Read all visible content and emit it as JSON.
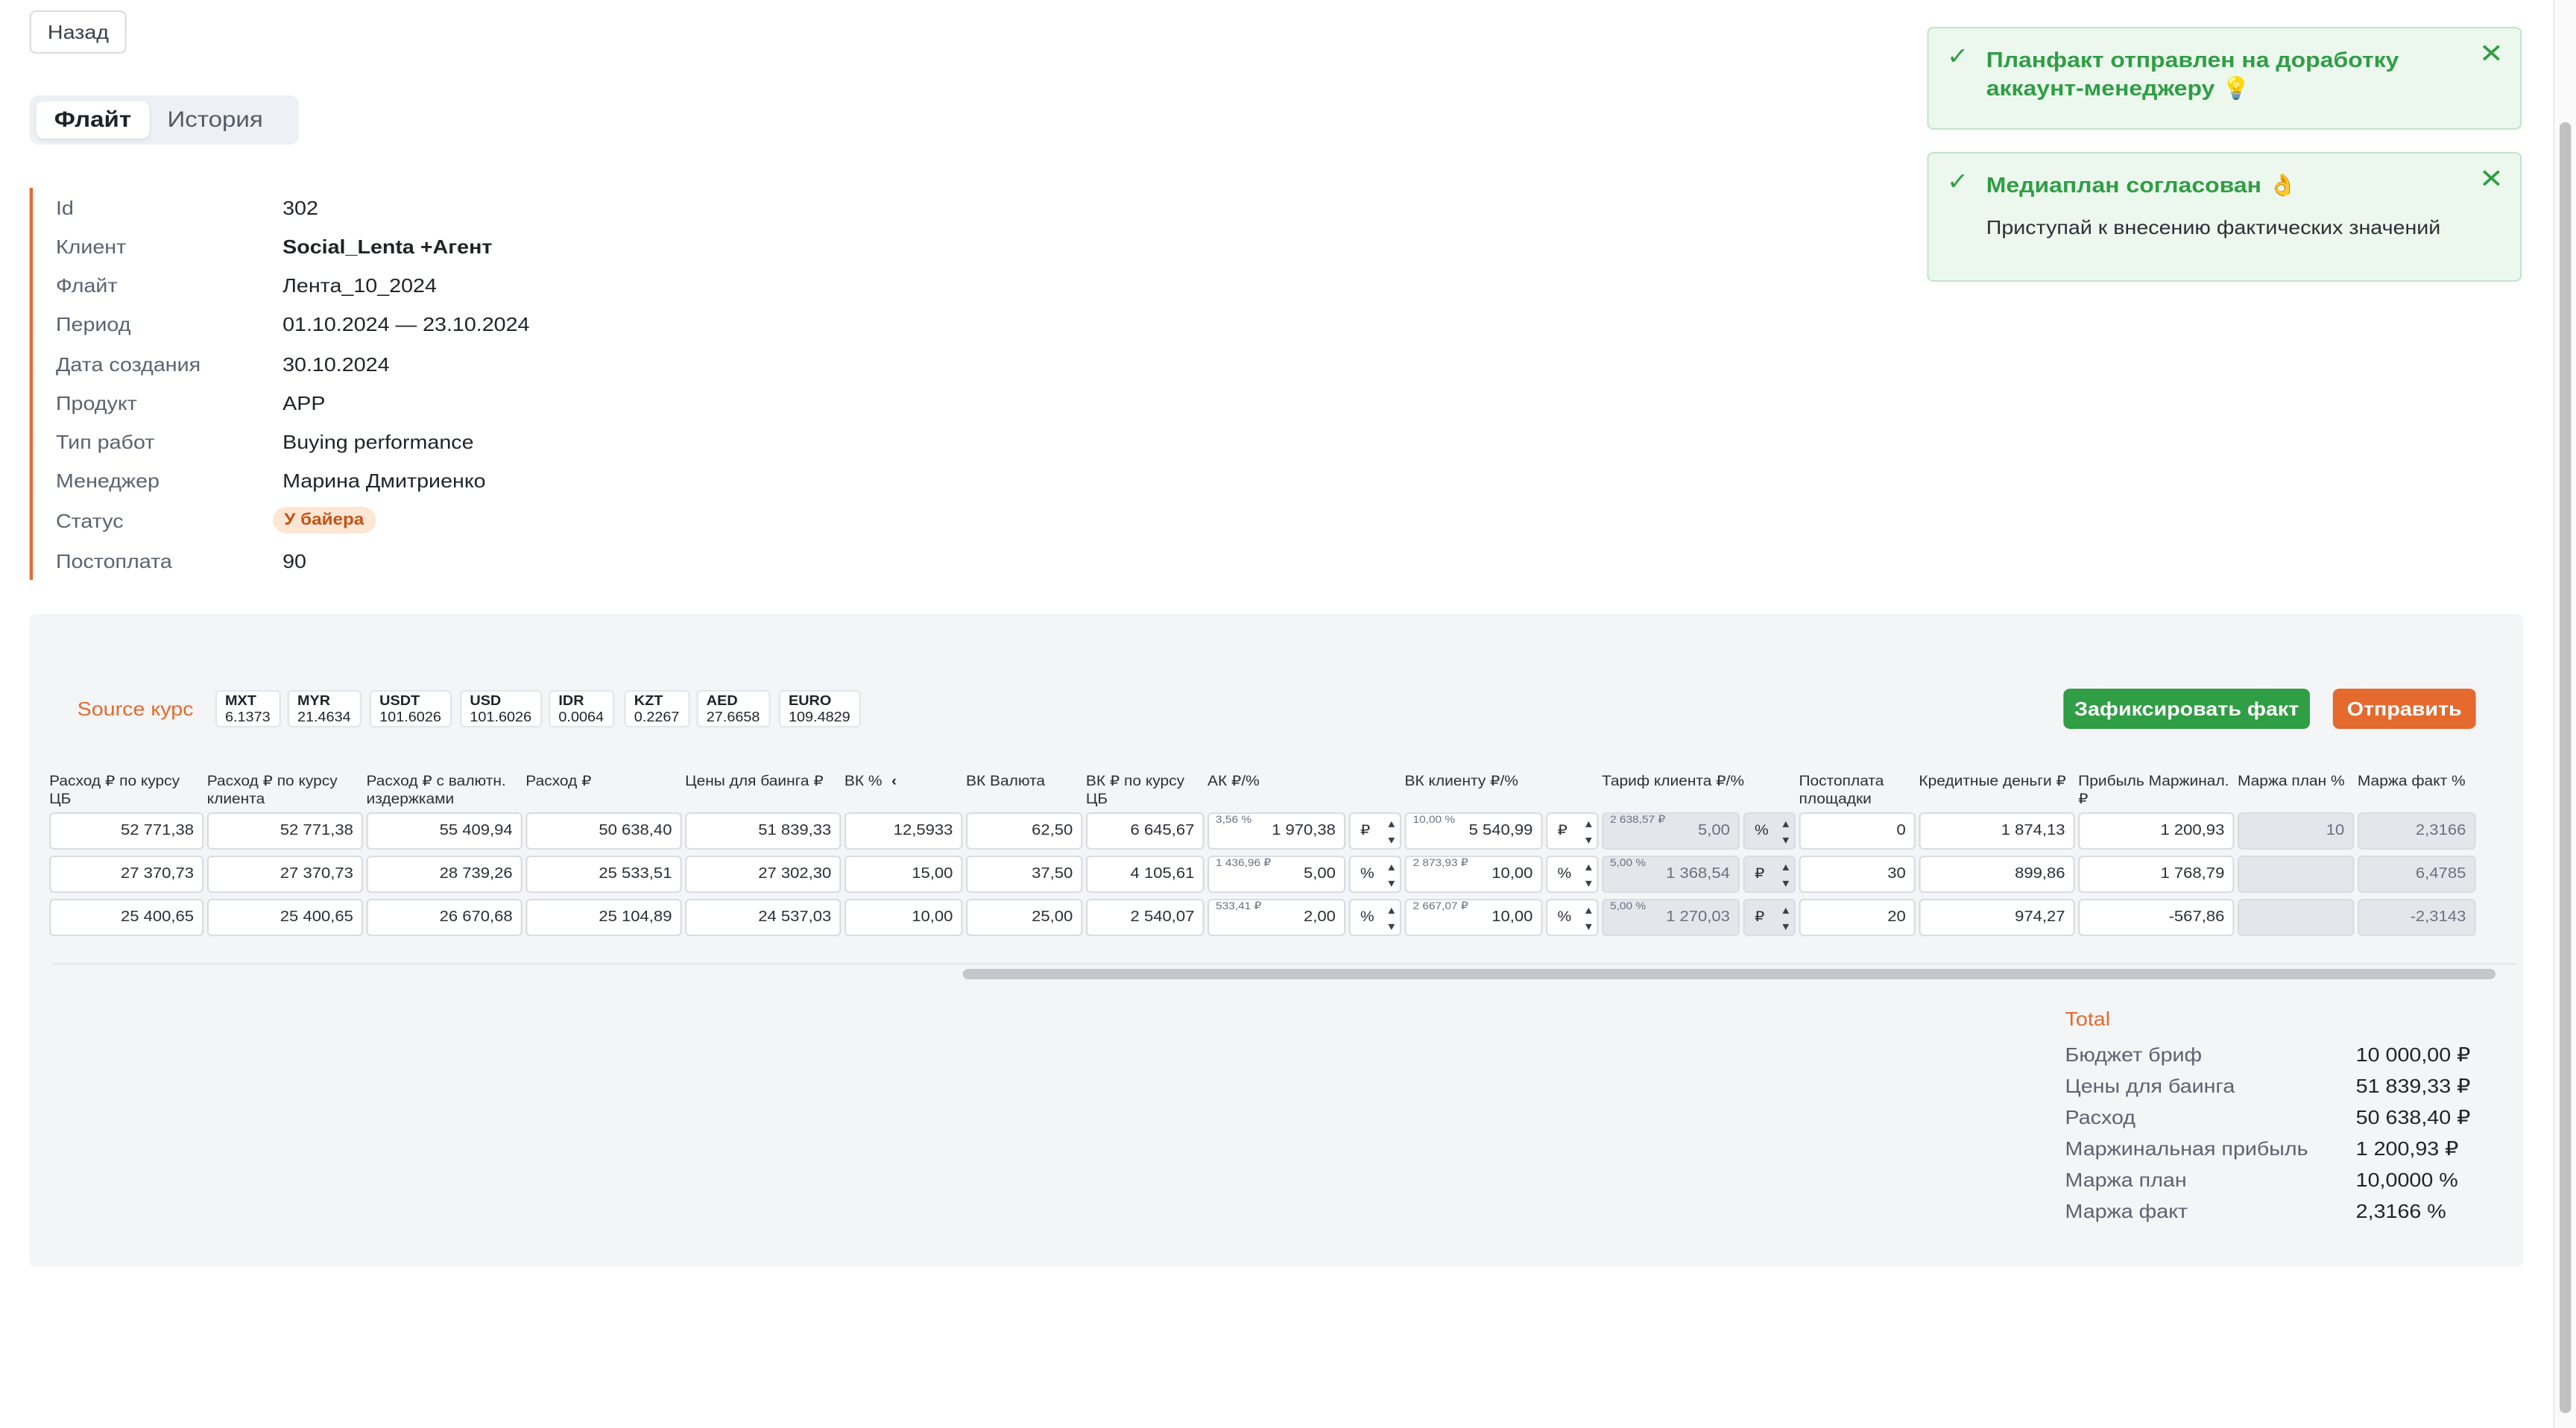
{
  "header": {
    "back_label": "Назад"
  },
  "tabs": [
    {
      "label": "Флайт"
    },
    {
      "label": "История"
    }
  ],
  "info": {
    "rows": [
      {
        "label": "Id",
        "value": "302"
      },
      {
        "label": "Клиент",
        "value": "Social_Lenta +Агент"
      },
      {
        "label": "Флайт",
        "value": "Лента_10_2024"
      },
      {
        "label": "Период",
        "value": "01.10.2024 — 23.10.2024"
      },
      {
        "label": "Дата создания",
        "value": "30.10.2024"
      },
      {
        "label": "Продукт",
        "value": "APP"
      },
      {
        "label": "Тип работ",
        "value": "Buying performance"
      },
      {
        "label": "Менеджер",
        "value": "Марина Дмитриенко"
      },
      {
        "label": "Статус",
        "value": "У байера"
      },
      {
        "label": "Постоплата",
        "value": "90"
      }
    ]
  },
  "toasts": [
    {
      "title": "Планфакт отправлен на доработку аккаунт-менеджеру 💡",
      "body": ""
    },
    {
      "title": "Медиаплан согласован 👌",
      "body": "Приступай к внесению фактических значений"
    }
  ],
  "rates": {
    "label": "Source курс",
    "items": [
      {
        "code": "MXT",
        "value": "6.1373"
      },
      {
        "code": "MYR",
        "value": "21.4634"
      },
      {
        "code": "USDT",
        "value": "101.6026"
      },
      {
        "code": "USD",
        "value": "101.6026"
      },
      {
        "code": "IDR",
        "value": "0.0064"
      },
      {
        "code": "KZT",
        "value": "0.2267"
      },
      {
        "code": "AED",
        "value": "27.6658"
      },
      {
        "code": "EURO",
        "value": "109.4829"
      }
    ]
  },
  "actions": {
    "fix_label": "Зафиксировать факт",
    "send_label": "Отправить"
  },
  "table": {
    "headers": {
      "h1": "Расход ₽ по курсу ЦБ",
      "h2": "Расход ₽ по курсу клиента",
      "h3": "Расход ₽ с валютн. издержками",
      "h4": "Расход ₽",
      "h5": "Цены для баинга ₽",
      "h6": "ВК %",
      "h7": "ВК Валюта",
      "h8": "ВК ₽ по курсу ЦБ",
      "h9": "АК ₽/%",
      "h10": "ВК клиенту ₽/%",
      "h11": "Тариф клиента ₽/%",
      "h12": "Постоплата площадки",
      "h13": "Кредитные деньги ₽",
      "h14": "Прибыль Маржинал. ₽",
      "h15": "Маржа план %",
      "h16": "Маржа факт %"
    },
    "rows": [
      {
        "c1": "52 771,38",
        "c2": "52 771,38",
        "c3": "55 409,94",
        "c4": "50 638,40",
        "c5": "51 839,33",
        "c6": "12,5933",
        "c7": "62,50",
        "c8": "6 645,67",
        "ak_sub": "3,56 %",
        "ak_val": "1 970,38",
        "ak_unit": "₽",
        "vk_sub": "10,00 %",
        "vk_val": "5 540,99",
        "vk_unit": "₽",
        "tar_sub": "2 638,57 ₽",
        "tar_val": "5,00",
        "tar_unit": "%",
        "c12": "0",
        "c13": "1 874,13",
        "c14": "1 200,93",
        "c15": "10",
        "c16": "2,3166"
      },
      {
        "c1": "27 370,73",
        "c2": "27 370,73",
        "c3": "28 739,26",
        "c4": "25 533,51",
        "c5": "27 302,30",
        "c6": "15,00",
        "c7": "37,50",
        "c8": "4 105,61",
        "ak_sub": "1 436,96 ₽",
        "ak_val": "5,00",
        "ak_unit": "%",
        "vk_sub": "2 873,93 ₽",
        "vk_val": "10,00",
        "vk_unit": "%",
        "tar_sub": "5,00 %",
        "tar_val": "1 368,54",
        "tar_unit": "₽",
        "c12": "30",
        "c13": "899,86",
        "c14": "1 768,79",
        "c15": "",
        "c16": "6,4785"
      },
      {
        "c1": "25 400,65",
        "c2": "25 400,65",
        "c3": "26 670,68",
        "c4": "25 104,89",
        "c5": "24 537,03",
        "c6": "10,00",
        "c7": "25,00",
        "c8": "2 540,07",
        "ak_sub": "533,41 ₽",
        "ak_val": "2,00",
        "ak_unit": "%",
        "vk_sub": "2 667,07 ₽",
        "vk_val": "10,00",
        "vk_unit": "%",
        "tar_sub": "5,00 %",
        "tar_val": "1 270,03",
        "tar_unit": "₽",
        "c12": "20",
        "c13": "974,27",
        "c14": "-567,86",
        "c15": "",
        "c16": "-2,3143"
      }
    ]
  },
  "totals": {
    "title": "Total",
    "rows": [
      {
        "label": "Бюджет бриф",
        "value": "10 000,00 ₽"
      },
      {
        "label": "Цены для баинга",
        "value": "51 839,33 ₽"
      },
      {
        "label": "Расход",
        "value": "50 638,40 ₽"
      },
      {
        "label": "Маржинальная прибыль",
        "value": "1 200,93 ₽"
      },
      {
        "label": "Маржа план",
        "value": "10,0000 %"
      },
      {
        "label": "Маржа факт",
        "value": "2,3166 %"
      }
    ]
  },
  "colors": {
    "accent": "#e56a2e",
    "success": "#2f9e44",
    "panel_bg": "#f4f5f7"
  }
}
